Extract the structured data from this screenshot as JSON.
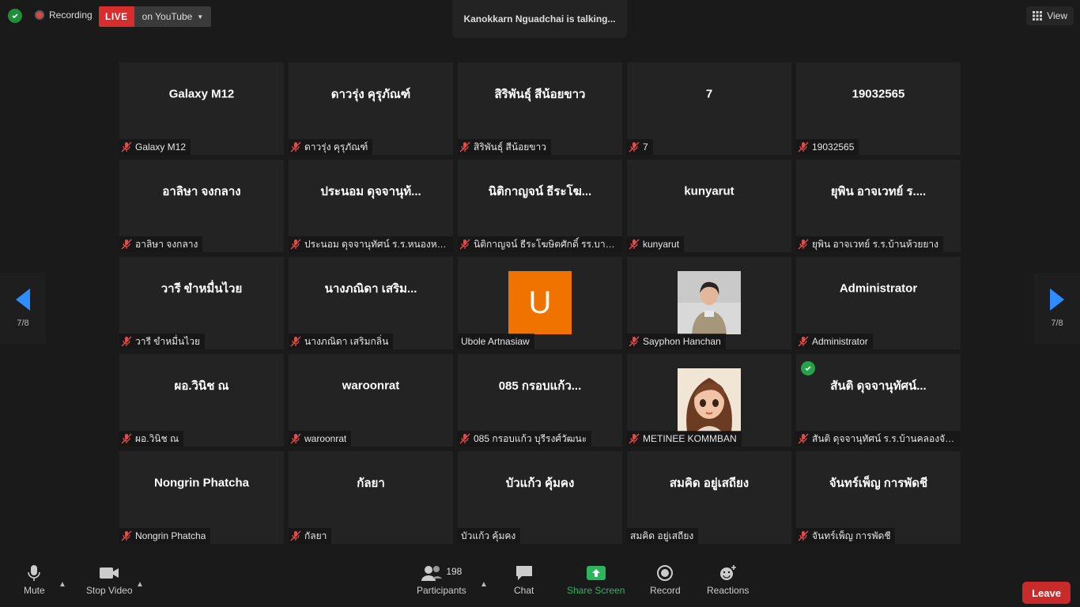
{
  "top": {
    "recording_label": "Recording",
    "live_badge": "LIVE",
    "live_destination": "on YouTube",
    "talking_text": "Kanokkarn Nguadchai is talking...",
    "view_label": "View"
  },
  "nav": {
    "page_left": "7/8",
    "page_right": "7/8"
  },
  "tiles": [
    {
      "title": "Galaxy M12",
      "label": "Galaxy M12"
    },
    {
      "title": "ดาวรุ่ง คุรุภัณฑ์",
      "label": "ดาวรุ่ง คุรุภัณฑ์"
    },
    {
      "title": "สิริพันธุ์ สีน้อยขาว",
      "label": "สิริพันธุ์ สีน้อยขาว"
    },
    {
      "title": "7",
      "label": "7"
    },
    {
      "title": "19032565",
      "label": "19032565"
    },
    {
      "title": "อาลิษา  จงกลาง",
      "label": "อาลิษา  จงกลาง"
    },
    {
      "title": "ประนอม ดุจจานุท้...",
      "label": "ประนอม ดุจจานุทัศน์ ร.ร.หนองหญ้..."
    },
    {
      "title": "นิติกาญจน์ ธีระโฆ...",
      "label": "นิติกาญจน์ ธีระโฆษิตศักดิ์ รร.บางขุนน..."
    },
    {
      "title": "kunyarut",
      "label": "kunyarut"
    },
    {
      "title": "ยุพิน  อาจเวทย์ ร....",
      "label": "ยุพิน  อาจเวทย์ ร.ร.บ้านห้วยยาง"
    },
    {
      "title": "วารี ขำหมื่นไวย",
      "label": "วารี ขำหมื่นไวย"
    },
    {
      "title": "นางภณิดา  เสริม...",
      "label": "นางภณิดา  เสริมกลิ่น"
    },
    {
      "title": "",
      "label": "Ubole Artnasiaw",
      "avatar": "U"
    },
    {
      "title": "",
      "label": "Sayphon Hanchan",
      "photo": "photo-1"
    },
    {
      "title": "Administrator",
      "label": "Administrator"
    },
    {
      "title": "ผอ.วินิช ณ",
      "label": "ผอ.วินิช ณ"
    },
    {
      "title": "waroonrat",
      "label": "waroonrat"
    },
    {
      "title": "085 กรอบแก้ว...",
      "label": "085 กรอบแก้ว    บุรีรงศ์วัฒนะ"
    },
    {
      "title": "",
      "label": "METINEE  KOMMBAN",
      "photo": "photo-2"
    },
    {
      "title": "สันติ  ดุจจานุทัศน์...",
      "label": "สันติ  ดุจจานุทัศน์ ร.ร.บ้านคลองจัน..."
    },
    {
      "title": "Nongrin Phatcha",
      "label": "Nongrin Phatcha"
    },
    {
      "title": "กัลยา",
      "label": "กัลยา"
    },
    {
      "title": "บัวแก้ว  คุ้มคง",
      "label": "บัวแก้ว  คุ้มคง"
    },
    {
      "title": "สมคิด อยู่เสถียง",
      "label": "สมคิด อยู่เสถียง"
    },
    {
      "title": "จันทร์เพ็ญ การพัดชี",
      "label": "จันทร์เพ็ญ การพัดชี"
    }
  ],
  "toolbar": {
    "mute": "Mute",
    "stop_video": "Stop Video",
    "participants": "Participants",
    "participants_count": "198",
    "chat": "Chat",
    "share_screen": "Share Screen",
    "record": "Record",
    "reactions": "Reactions",
    "leave": "Leave"
  },
  "colors": {
    "live": "#d92c2c",
    "share": "#2db55d",
    "leave": "#c92b2b",
    "avatar_u": "#f07300"
  }
}
